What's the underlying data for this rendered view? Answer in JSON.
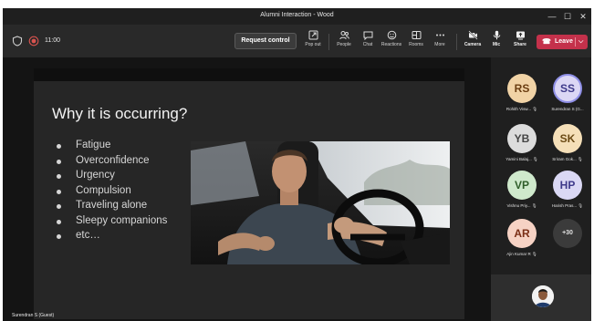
{
  "window": {
    "title": "Alumni Interaction - Wood",
    "controls": {
      "minimize": "—",
      "maximize": "☐",
      "close": "✕"
    }
  },
  "toolbar": {
    "timer": "11:00",
    "request_control": "Request control",
    "buttons": [
      {
        "label": "Pop out",
        "icon": "popout-icon"
      },
      {
        "label": "People",
        "icon": "people-icon"
      },
      {
        "label": "Chat",
        "icon": "chat-icon"
      },
      {
        "label": "Reactions",
        "icon": "reactions-icon"
      },
      {
        "label": "Rooms",
        "icon": "rooms-icon"
      },
      {
        "label": "More",
        "icon": "more-icon"
      },
      {
        "label": "Camera",
        "icon": "camera-icon"
      },
      {
        "label": "Mic",
        "icon": "mic-icon"
      },
      {
        "label": "Share",
        "icon": "share-icon"
      }
    ],
    "leave": "Leave"
  },
  "slide": {
    "title": "Why it is occurring?",
    "bullets": [
      "Fatigue",
      "Overconfidence",
      "Urgency",
      "Compulsion",
      "Traveling alone",
      "Sleepy companions",
      "etc…"
    ]
  },
  "presenter": "Surendran S (Guest)",
  "participants": [
    {
      "initials": "RS",
      "name": "Rohith Visw...",
      "bg": "#f1d3a6",
      "fg": "#6b3e12",
      "muted": true
    },
    {
      "initials": "SS",
      "name": "Surendran S (G...",
      "bg": "#dcd7f5",
      "fg": "#3e3a8a",
      "muted": false,
      "speaking": true
    },
    {
      "initials": "YB",
      "name": "Yamini Balaj...",
      "bg": "#dcdcdc",
      "fg": "#444444",
      "muted": true
    },
    {
      "initials": "SK",
      "name": "Sriram Gok...",
      "bg": "#f5dfb8",
      "fg": "#6b4a14",
      "muted": true
    },
    {
      "initials": "VP",
      "name": "Vishnu Priy...",
      "bg": "#cfe9cc",
      "fg": "#2f5e2a",
      "muted": true
    },
    {
      "initials": "HP",
      "name": "Harish Pras...",
      "bg": "#dad8f4",
      "fg": "#3e3a8a",
      "muted": true
    },
    {
      "initials": "AR",
      "name": "Ajin Kumar R",
      "bg": "#f6d2c4",
      "fg": "#7a2e16",
      "muted": true
    }
  ],
  "more_participants": "+30",
  "mic_muted_glyph": "🎙",
  "colors": {
    "accent": "#8f8fe6",
    "leave": "#c4314b"
  }
}
